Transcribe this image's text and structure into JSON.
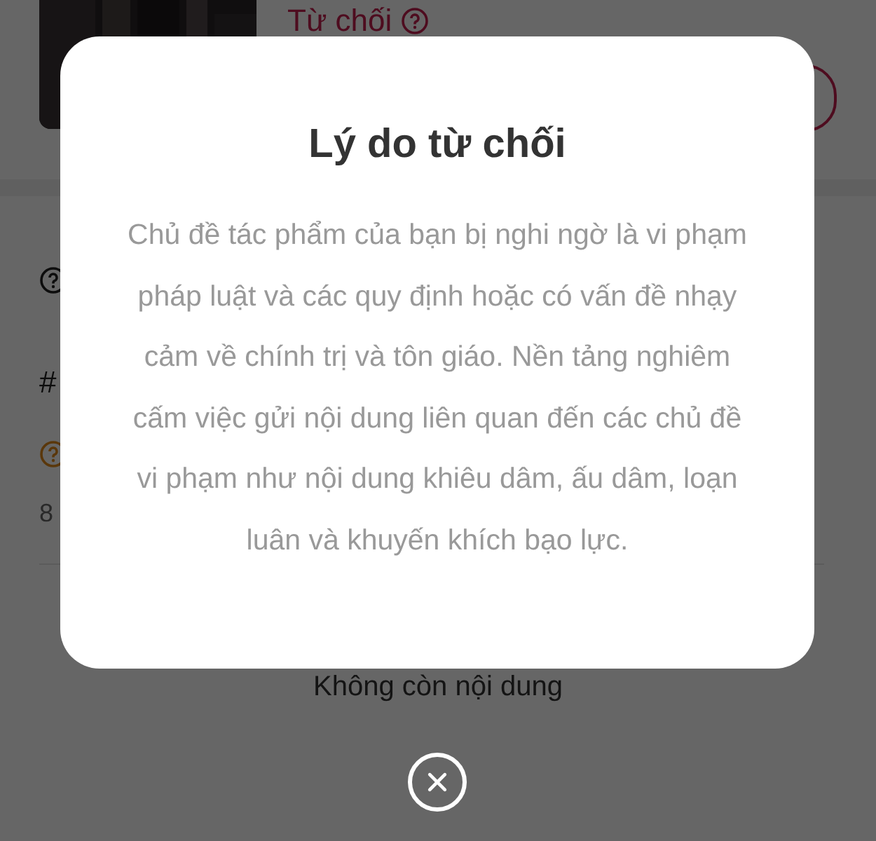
{
  "background": {
    "status": "Từ chối",
    "hash": "#",
    "count": "8",
    "end_text": "Không còn nội dung"
  },
  "dialog": {
    "title": "Lý do từ chối",
    "message": "Chủ đề tác phẩm của bạn bị nghi ngờ là vi phạm pháp luật và các quy định hoặc có vấn đề nhạy cảm về chính trị và tôn giáo. Nền tảng nghiêm cấm việc gửi nội dung liên quan đến các chủ đề vi phạm như nội dung khiêu dâm, ấu dâm, loạn luân và khuyến khích bạo lực."
  }
}
